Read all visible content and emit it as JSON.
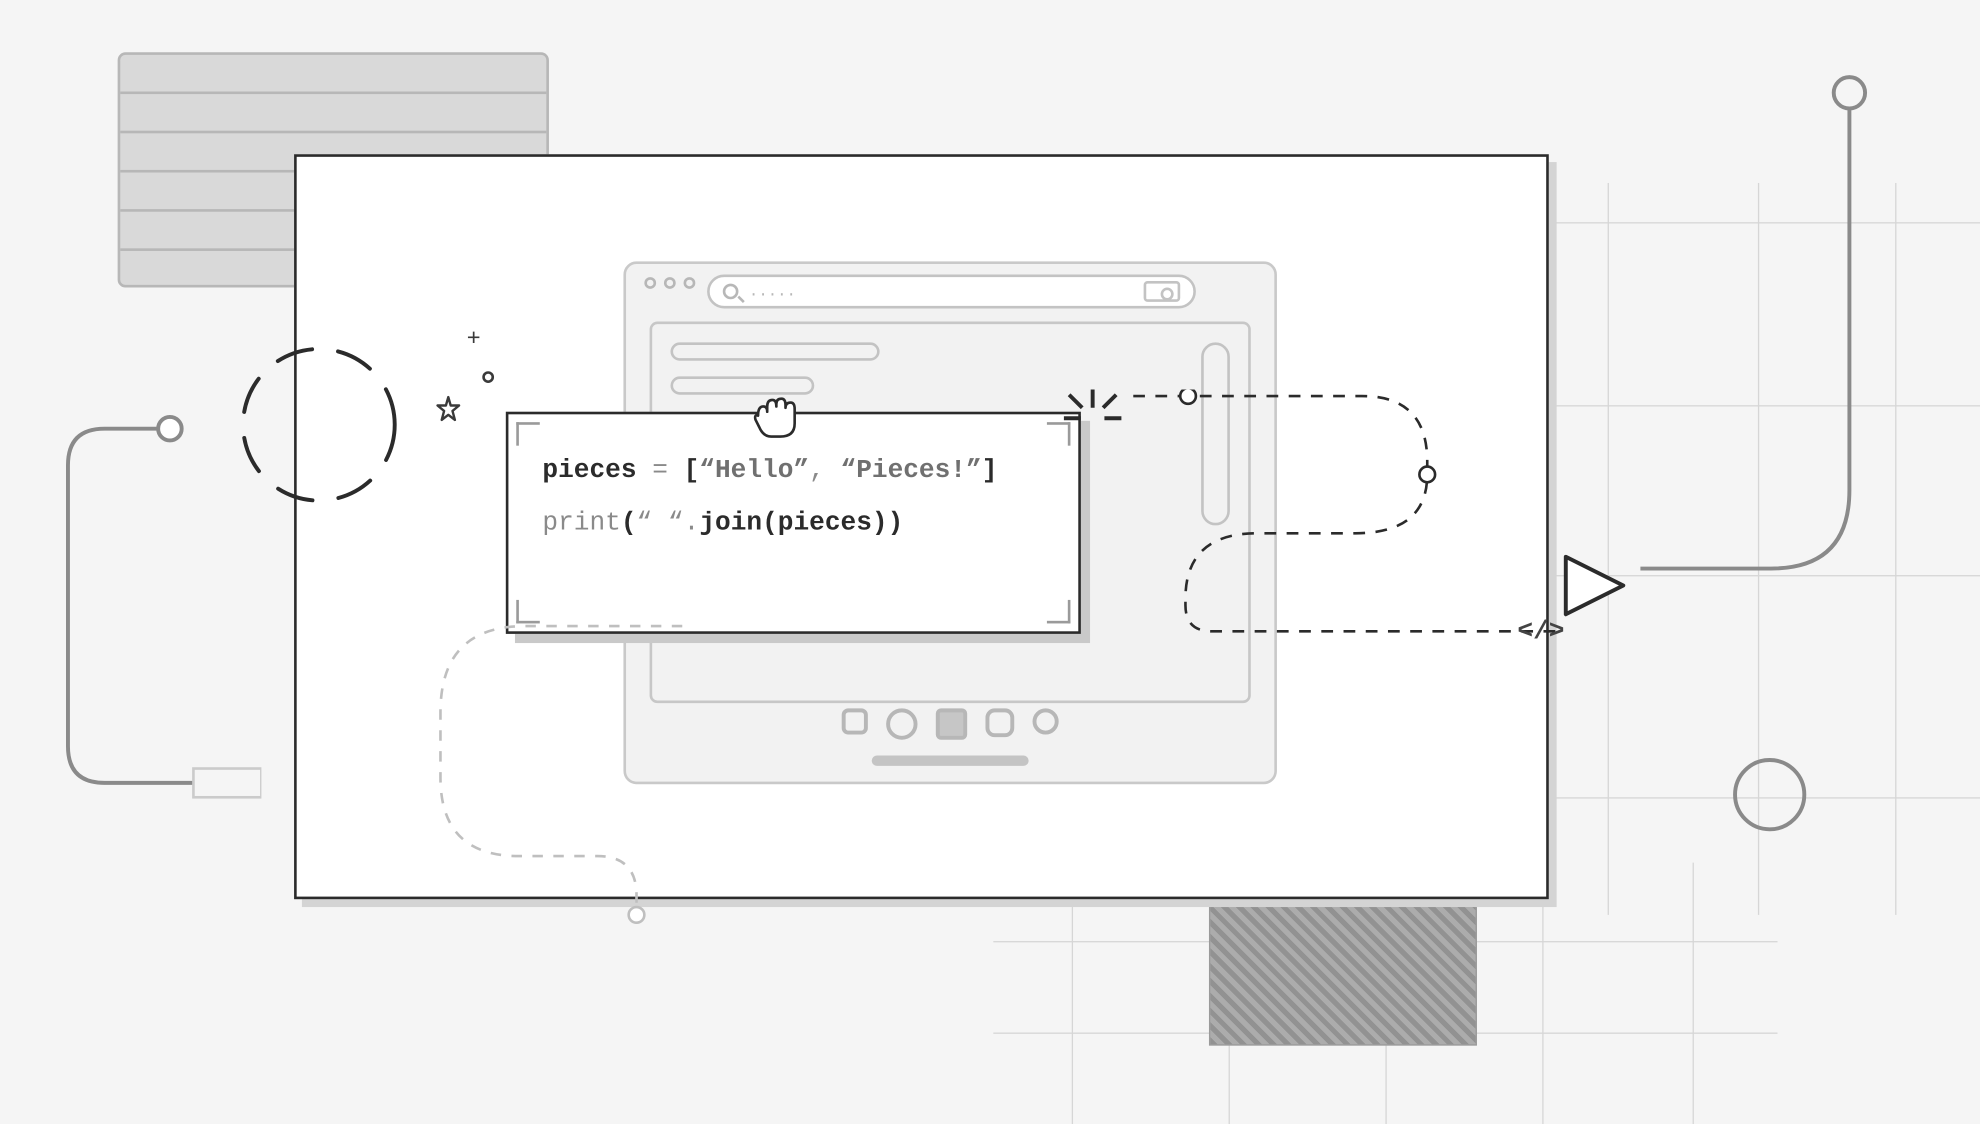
{
  "code_snippet": {
    "line1": {
      "var": "pieces",
      "eq": " = ",
      "open": "[",
      "str1": "“Hello”",
      "comma": ", ",
      "str2": "“Pieces!”",
      "close": "]"
    },
    "line2": {
      "fn": "print",
      "open": "(",
      "arg_str": "“ “",
      "dot": ".",
      "method": "join",
      "open2": "(",
      "arg_var": "pieces",
      "close2": ")",
      "close": ")"
    }
  },
  "search_placeholder": ".....",
  "code_glyph": "</>"
}
